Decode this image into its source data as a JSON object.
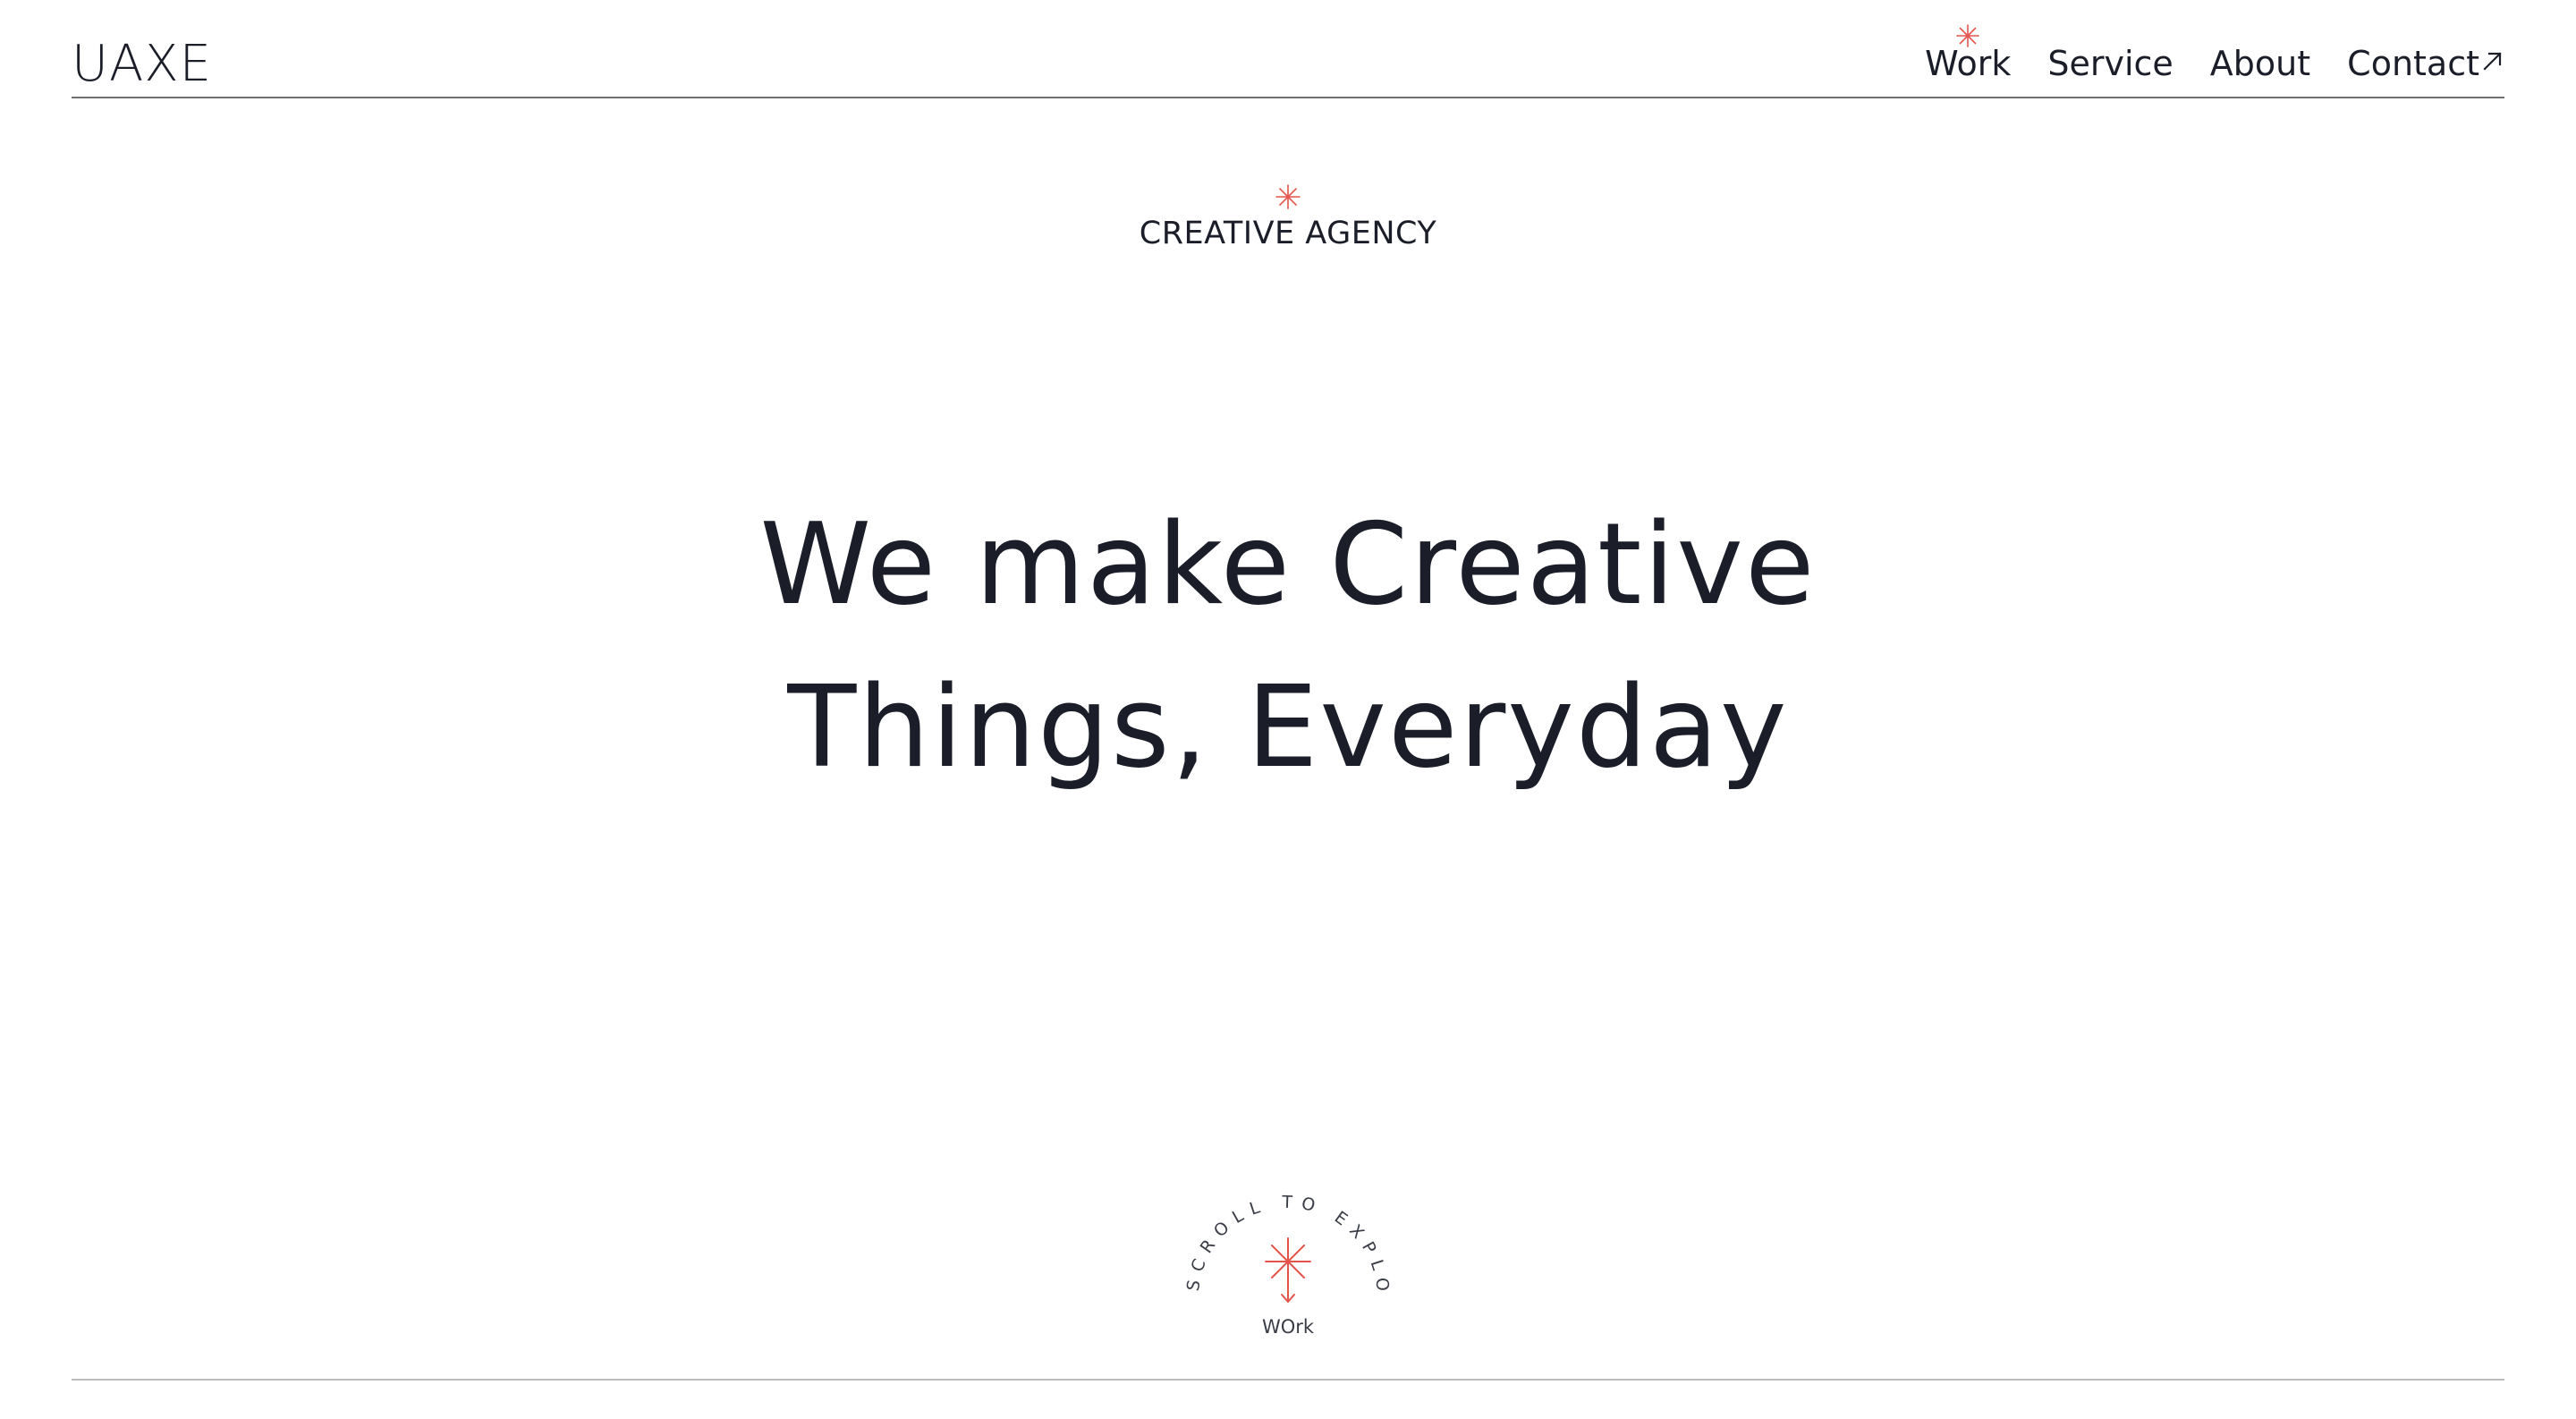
{
  "brand": {
    "logo": "UAXE"
  },
  "nav": {
    "items": [
      {
        "label": "Work",
        "active": true
      },
      {
        "label": "Service"
      },
      {
        "label": "About"
      },
      {
        "label": "Contact",
        "icon": "arrow-up-right-icon"
      }
    ]
  },
  "hero": {
    "eyebrow": "CREATIVE AGENCY",
    "headline_line1": "We make Creative",
    "headline_line2": "Things, Everyday"
  },
  "scroll": {
    "circle_text": "SCROLL TO EXPLORE",
    "label": "WOrk",
    "icon": "arrow-down-icon"
  },
  "colors": {
    "accent": "#e5544b",
    "text": "#1b1e28",
    "rule": "#6f6f73",
    "background": "#ffffff"
  }
}
